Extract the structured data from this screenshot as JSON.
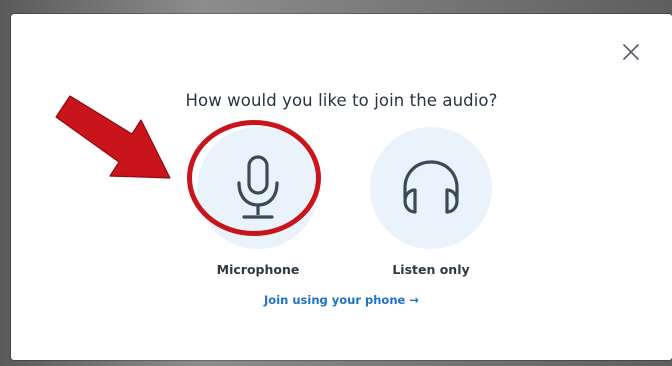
{
  "dialog": {
    "prompt": "How would you like to join the audio?",
    "close_icon": "close-icon",
    "options": [
      {
        "label": "Microphone",
        "icon": "microphone-icon"
      },
      {
        "label": "Listen only",
        "icon": "headphones-icon"
      }
    ],
    "phone_link": "Join using your phone →"
  },
  "annotation": {
    "arrow_icon": "red-pointer-arrow",
    "ring": "red-highlight-circle",
    "color": "#c8141a"
  },
  "colors": {
    "option_bg": "#eaf2fb",
    "icon_stroke": "#3b4a59",
    "link": "#1f73c4"
  }
}
